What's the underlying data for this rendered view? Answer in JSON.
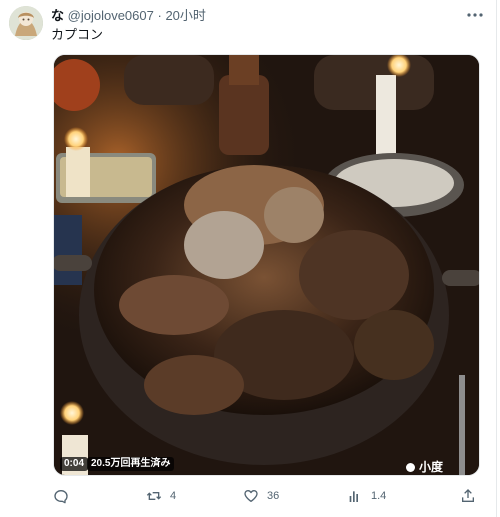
{
  "post": {
    "display_name": "な",
    "handle": "@jojolove0607",
    "separator": "·",
    "timestamp": "20小时",
    "text": "カプコン"
  },
  "media": {
    "video_time": "0:04",
    "view_count": "20.5万回再生済み",
    "watermark": "小度"
  },
  "actions": {
    "reply": {
      "icon": "reply-icon",
      "count": ""
    },
    "repost": {
      "icon": "repost-icon",
      "count": "4"
    },
    "like": {
      "icon": "heart-icon",
      "count": "36"
    },
    "views": {
      "icon": "views-icon",
      "count": "1.4"
    },
    "share": {
      "icon": "share-icon",
      "count": ""
    }
  },
  "colors": {
    "text_primary": "#0f1419",
    "text_secondary": "#536471",
    "border": "#e6e9eb"
  }
}
